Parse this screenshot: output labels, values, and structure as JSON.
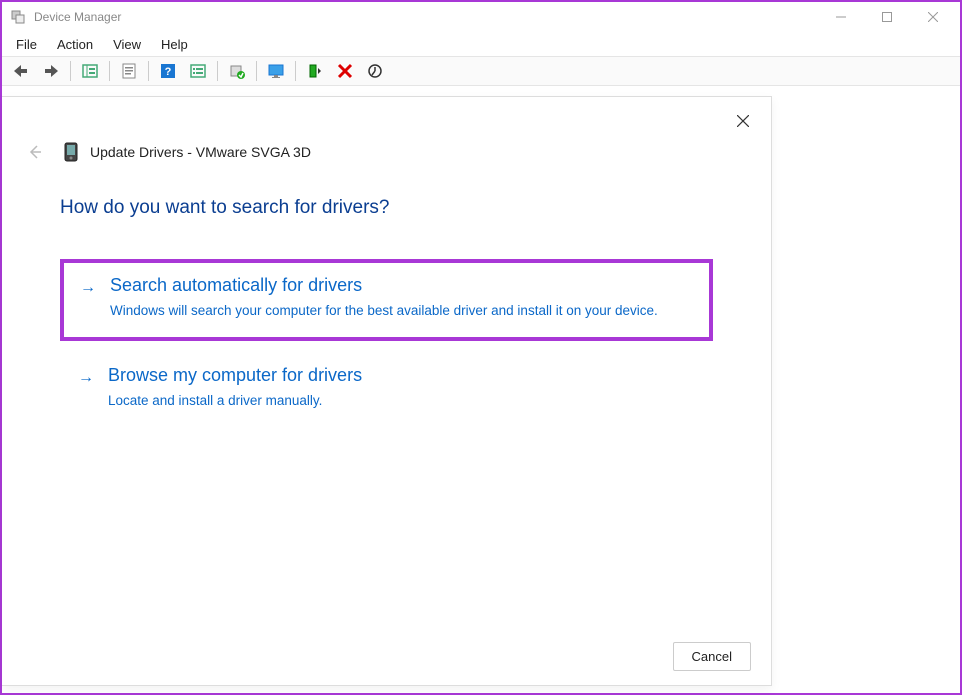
{
  "window": {
    "title": "Device Manager"
  },
  "menu": {
    "file": "File",
    "action": "Action",
    "view": "View",
    "help": "Help"
  },
  "dialog": {
    "title": "Update Drivers - VMware SVGA 3D",
    "question": "How do you want to search for drivers?",
    "option1": {
      "title": "Search automatically for drivers",
      "desc": "Windows will search your computer for the best available driver and install it on your device."
    },
    "option2": {
      "title": "Browse my computer for drivers",
      "desc": "Locate and install a driver manually."
    },
    "cancel": "Cancel"
  }
}
